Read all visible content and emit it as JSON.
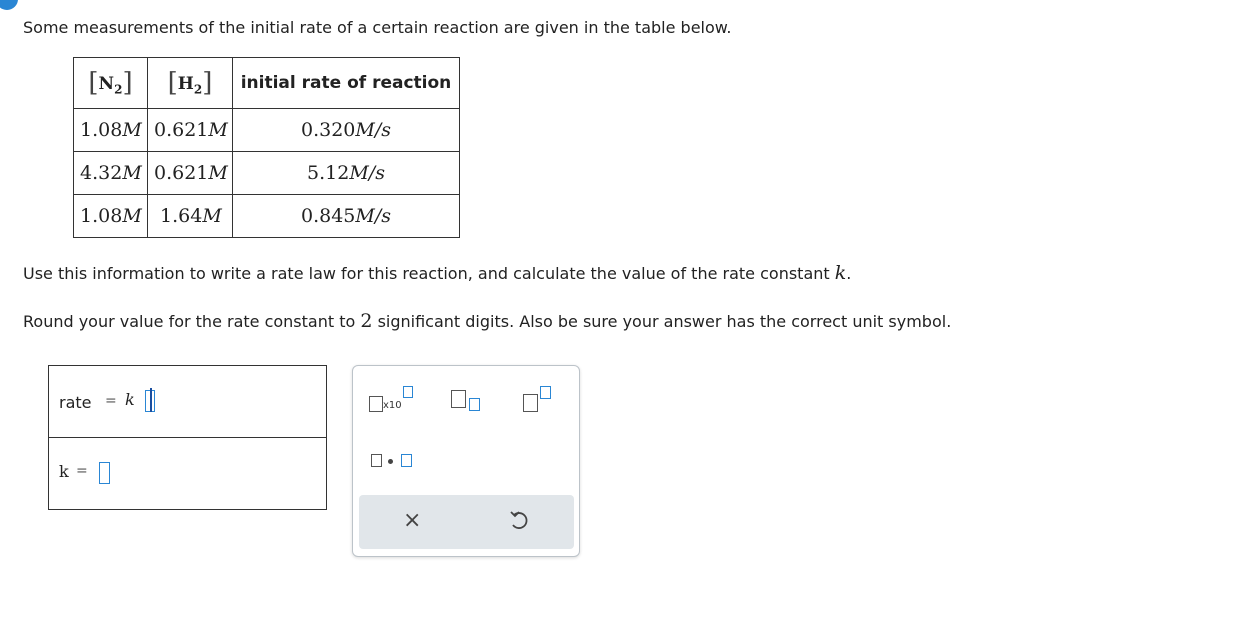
{
  "intro_text": "Some measurements of the initial rate of a certain reaction are given in the table below.",
  "table": {
    "headers": {
      "col1_species": "N",
      "col1_sub": "2",
      "col2_species": "H",
      "col2_sub": "2",
      "col3": "initial rate of reaction"
    },
    "unit_M": "M",
    "unit_rate": "M/s",
    "rows": [
      {
        "n2": "1.08",
        "h2": "0.621",
        "rate": "0.320"
      },
      {
        "n2": "4.32",
        "h2": "0.621",
        "rate": "5.12"
      },
      {
        "n2": "1.08",
        "h2": "1.64",
        "rate": "0.845"
      }
    ]
  },
  "instruction1": {
    "text": "Use this information to write a rate law for this reaction, and calculate the value of the rate constant",
    "var": "k",
    "end": "."
  },
  "instruction2": {
    "before": "Round your value for the rate constant to",
    "num": "2",
    "after": "significant digits. Also be sure your answer has the correct unit symbol."
  },
  "answer": {
    "rate_label": "rate",
    "equals": "=",
    "k_symbol": "k",
    "k_label": "k"
  },
  "toolbar": {
    "x10_label": "x10",
    "clear_symbol": "×",
    "icons": [
      "exponent-x10-icon",
      "subscript-icon",
      "superscript-icon",
      "multiply-dot-icon",
      "clear-icon",
      "undo-icon"
    ]
  }
}
